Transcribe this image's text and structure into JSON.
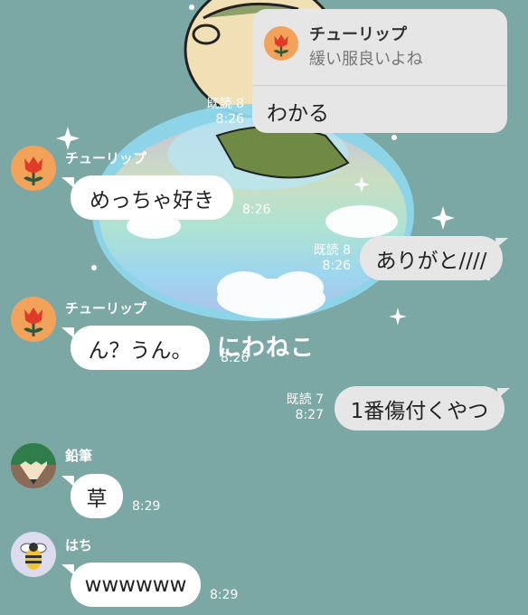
{
  "messages": [
    {
      "id": "m0",
      "sender": "me",
      "text": "わかる",
      "read": "既読 8",
      "time": "8:26",
      "reply_to": {
        "sender": "チューリップ",
        "text": "緩い服良いよね"
      }
    },
    {
      "id": "m1",
      "sender": "チューリップ",
      "text": "めっちゃ好き",
      "time": "8:26"
    },
    {
      "id": "m2",
      "sender": "me",
      "text": "ありがと////",
      "read": "既読 8",
      "time": "8:26"
    },
    {
      "id": "m3",
      "sender": "チューリップ",
      "text": "ん？うん。",
      "time": "8:26"
    },
    {
      "id": "m4",
      "sender": "me",
      "text": "1番傷付くやつ",
      "read": "既読 7",
      "time": "8:27"
    },
    {
      "id": "m5",
      "sender": "鉛筆",
      "text": "草",
      "time": "8:29"
    },
    {
      "id": "m6",
      "sender": "はち",
      "text": "wwwwww",
      "time": "8:29"
    }
  ],
  "wallpaper": {
    "signature": "にわねこ"
  },
  "avatars": {
    "tulip": "tulip-icon",
    "pencil": "pencil-icon",
    "bee": "bee-icon"
  },
  "colors": {
    "background": "#7ba8a4",
    "incoming": "#ffffff",
    "outgoing": "#e6e6e6",
    "tulip_avatar": "#f3a25a"
  }
}
